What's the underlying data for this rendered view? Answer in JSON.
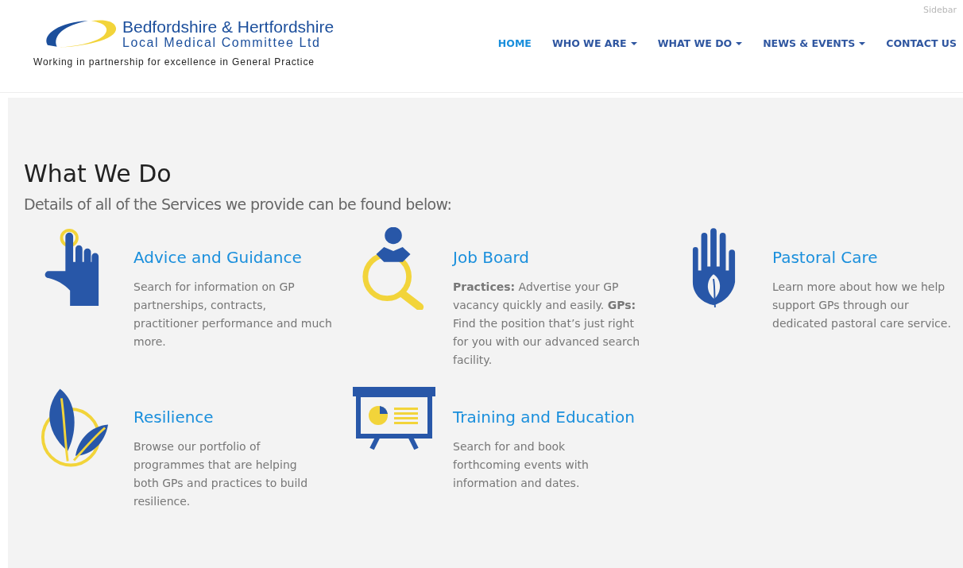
{
  "header": {
    "logo": {
      "line_1": "Bedfordshire & Hertfordshire",
      "line_2": "Local Medical Committee Ltd",
      "tagline": "Working in partnership for excellence in General Practice"
    },
    "sidebar_label": "Sidebar",
    "nav": [
      {
        "label": "HOME",
        "selected": true,
        "has_menu": false
      },
      {
        "label": "WHO WE ARE",
        "selected": false,
        "has_menu": true
      },
      {
        "label": "WHAT WE DO",
        "selected": false,
        "has_menu": true
      },
      {
        "label": "NEWS & EVENTS",
        "selected": false,
        "has_menu": true
      },
      {
        "label": "CONTACT US",
        "selected": false,
        "has_menu": false
      }
    ]
  },
  "page": {
    "title": "What We Do",
    "subtitle": "Details of all of the Services we provide can be found below:",
    "services": [
      {
        "kind": "pointer",
        "title": "Advice and Guidance",
        "text": "Search for information on GP partnerships, contracts, practitioner performance and much more."
      },
      {
        "kind": "search-person",
        "title": "Job Board",
        "text": "**Practices:** Advertise your GP vacancy quickly and easily. **GPs:** Find the position that’s just right for you with our advanced search facility."
      },
      {
        "kind": "hand-leaf",
        "title": "Pastoral Care",
        "text": "Learn more about how we help support GPs through our dedicated pastoral care service."
      },
      {
        "kind": "leaves",
        "title": "Resilience",
        "text": "Browse our portfolio of programmes that are helping both GPs and practices to build resilience."
      },
      {
        "kind": "presentation",
        "title": "Training and Education",
        "text": "Search for and book forthcoming events with information and dates."
      }
    ]
  }
}
